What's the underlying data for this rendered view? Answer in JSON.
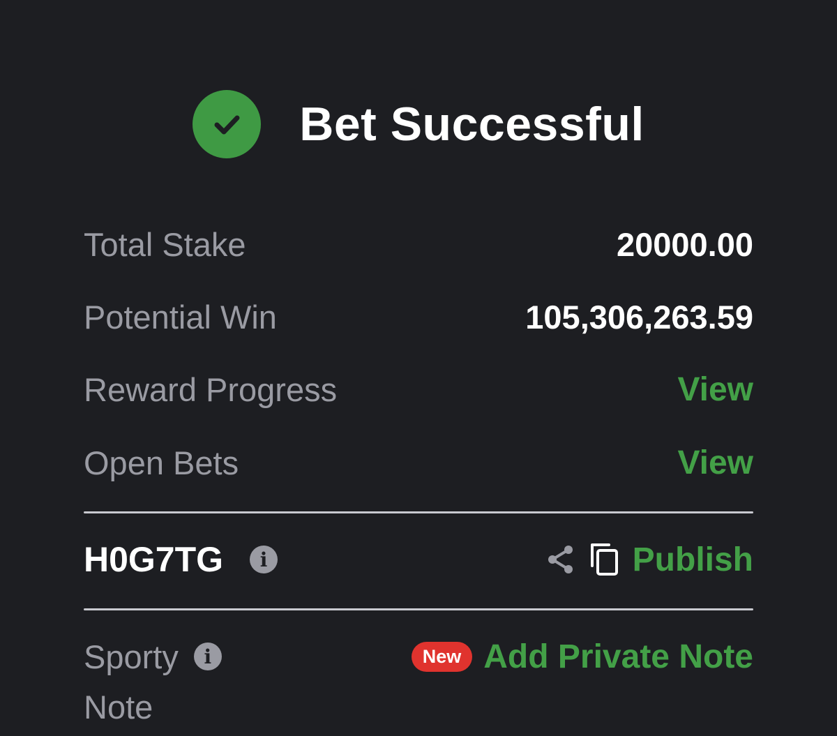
{
  "header": {
    "title": "Bet Successful",
    "status_color": "#3f9a44"
  },
  "summary": {
    "total_stake_label": "Total Stake",
    "total_stake_value": "20000.00",
    "potential_win_label": "Potential Win",
    "potential_win_value": "105,306,263.59",
    "reward_progress_label": "Reward Progress",
    "reward_progress_link": "View",
    "open_bets_label": "Open Bets",
    "open_bets_link": "View"
  },
  "booking": {
    "code": "H0G7TG",
    "share_icon": "share-icon",
    "copy_icon": "copy-icon",
    "publish_label": "Publish"
  },
  "note": {
    "label_line1": "Sporty",
    "label_line2": "Note",
    "badge": "New",
    "add_label": "Add Private Note"
  },
  "colors": {
    "background": "#1d1e22",
    "accent": "#43a047",
    "muted_text": "#9a9ba3",
    "badge": "#e0332e"
  }
}
